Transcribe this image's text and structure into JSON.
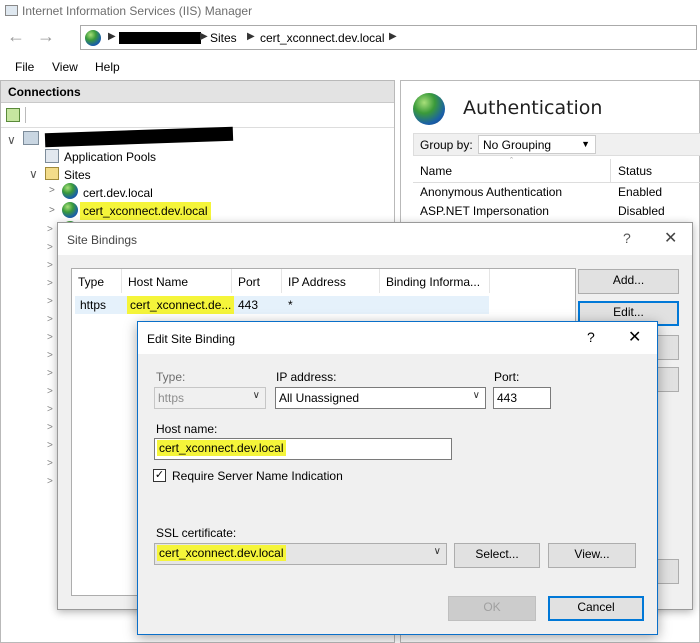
{
  "window": {
    "title": "Internet Information Services (IIS) Manager"
  },
  "breadcrumb": {
    "items": [
      "Sites",
      "cert_xconnect.dev.local"
    ]
  },
  "menu": [
    "File",
    "View",
    "Help"
  ],
  "connections": {
    "header": "Connections",
    "tree": {
      "app_pools": "Application Pools",
      "sites": "Sites",
      "site1": "cert.dev.local",
      "site2": "cert_xconnect.dev.local"
    }
  },
  "auth": {
    "title": "Authentication",
    "group_by_label": "Group by:",
    "group_by_value": "No Grouping",
    "columns": [
      "Name",
      "Status"
    ],
    "rows": [
      {
        "name": "Anonymous Authentication",
        "status": "Enabled"
      },
      {
        "name": "ASP.NET Impersonation",
        "status": "Disabled"
      }
    ]
  },
  "site_bindings": {
    "title": "Site Bindings",
    "columns": [
      "Type",
      "Host Name",
      "Port",
      "IP Address",
      "Binding Informa..."
    ],
    "row": {
      "type": "https",
      "host": "cert_xconnect.de...",
      "port": "443",
      "ip": "*",
      "info": ""
    },
    "buttons": {
      "add": "Add...",
      "edit": "Edit..."
    }
  },
  "edit_binding": {
    "title": "Edit Site Binding",
    "type_label": "Type:",
    "type_value": "https",
    "ip_label": "IP address:",
    "ip_value": "All Unassigned",
    "port_label": "Port:",
    "port_value": "443",
    "host_label": "Host name:",
    "host_value": "cert_xconnect.dev.local",
    "sni_label": "Require Server Name Indication",
    "ssl_label": "SSL certificate:",
    "ssl_value": "cert_xconnect.dev.local",
    "select_btn": "Select...",
    "view_btn": "View...",
    "ok_btn": "OK",
    "cancel_btn": "Cancel"
  },
  "colors": {
    "highlight": "#f5f53a",
    "accent": "#0078d7"
  }
}
